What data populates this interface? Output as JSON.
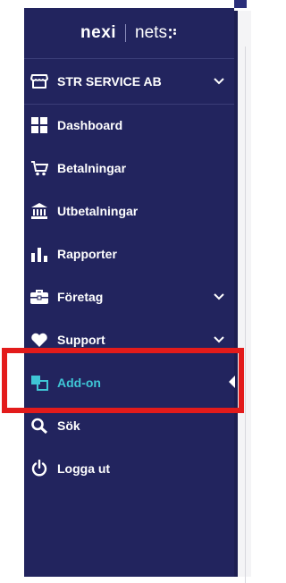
{
  "logo": {
    "brand_primary": "nexi",
    "brand_secondary": "nets"
  },
  "merchant": {
    "name": "STR SERVICE AB",
    "icon": "store-icon",
    "expand_icon": "chevron-down-icon"
  },
  "menu": {
    "items": [
      {
        "label": "Dashboard",
        "icon": "dashboard-grid-icon"
      },
      {
        "label": "Betalningar",
        "icon": "cart-icon"
      },
      {
        "label": "Utbetalningar",
        "icon": "bank-icon"
      },
      {
        "label": "Rapporter",
        "icon": "bar-chart-icon"
      },
      {
        "label": "Företag",
        "icon": "briefcase-icon",
        "expandable": true
      },
      {
        "label": "Support",
        "icon": "heart-icon",
        "expandable": true
      },
      {
        "label": "Add-on",
        "icon": "add-on-icon",
        "active": true
      },
      {
        "label": "Sök",
        "icon": "search-icon"
      },
      {
        "label": "Logga ut",
        "icon": "power-icon"
      }
    ]
  },
  "colors": {
    "sidebar_bg": "#22245e",
    "active_text": "#3fc6d6",
    "highlight_border": "#e31b1b"
  }
}
